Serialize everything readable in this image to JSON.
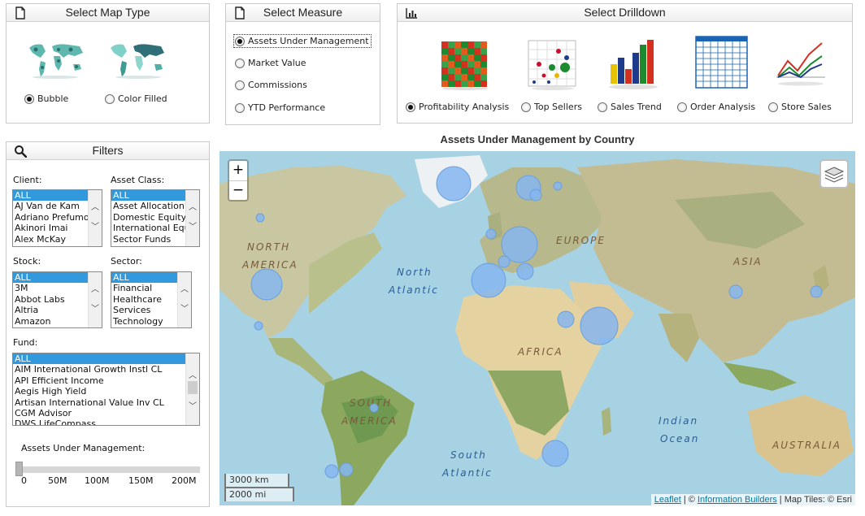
{
  "map_type": {
    "title": "Select Map Type",
    "options": [
      "Bubble",
      "Color Filled"
    ],
    "selected": "Bubble"
  },
  "measure": {
    "title": "Select Measure",
    "options": [
      "Assets Under Management",
      "Market Value",
      "Commissions",
      "YTD Performance"
    ],
    "selected": "Assets Under Management"
  },
  "drilldown": {
    "title": "Select Drilldown",
    "options": [
      "Profitability Analysis",
      "Top Sellers",
      "Sales Trend",
      "Order Analysis",
      "Store Sales"
    ],
    "selected": "Profitability Analysis"
  },
  "filters": {
    "title": "Filters",
    "client": {
      "label": "Client:",
      "items": [
        "ALL",
        "AJ Van de Kam",
        "Adriano Prefumo",
        "Akinori Imai",
        "Alex McKay"
      ]
    },
    "asset_class": {
      "label": "Asset Class:",
      "items": [
        "ALL",
        "Asset Allocation",
        "Domestic Equity",
        "International Equity",
        "Sector Funds"
      ]
    },
    "stock": {
      "label": "Stock:",
      "items": [
        "ALL",
        "3M",
        "Abbot Labs",
        "Altria",
        "Amazon"
      ]
    },
    "sector": {
      "label": "Sector:",
      "items": [
        "ALL",
        "Financial",
        "Healthcare",
        "Services",
        "Technology"
      ]
    },
    "fund": {
      "label": "Fund:",
      "items": [
        "ALL",
        "AIM International Growth Instl CL",
        "API Efficient Income",
        "Aegis High Yield",
        "Artisan International Value Inv CL",
        "CGM Advisor",
        "DWS LifeCompass"
      ]
    },
    "slider_label": "Assets Under Management:",
    "slider_ticks": [
      "0",
      "50M",
      "100M",
      "150M",
      "200M"
    ],
    "slider_value": "0"
  },
  "map": {
    "title": "Assets Under Management by Country",
    "zoom_in": "+",
    "zoom_out": "−",
    "scale_km": "3000 km",
    "scale_mi": "2000 mi",
    "labels": {
      "north_america_1": "NORTH",
      "north_america_2": "AMERICA",
      "europe": "EUROPE",
      "asia": "ASIA",
      "africa": "AFRICA",
      "south_america_1": "SOUTH",
      "south_america_2": "AMERICA",
      "australia": "AUSTRALIA",
      "north_atlantic_1": "North",
      "north_atlantic_2": "Atlantic",
      "south_atlantic_1": "South",
      "south_atlantic_2": "Atlantic",
      "indian_ocean_1": "Indian",
      "indian_ocean_2": "Ocean"
    },
    "attribution": {
      "leaflet": "Leaflet",
      "sep": " | © ",
      "ib": "Information Builders",
      "tiles": " | Map Tiles: © Esri"
    },
    "bubble_color": "#86b6f0"
  }
}
